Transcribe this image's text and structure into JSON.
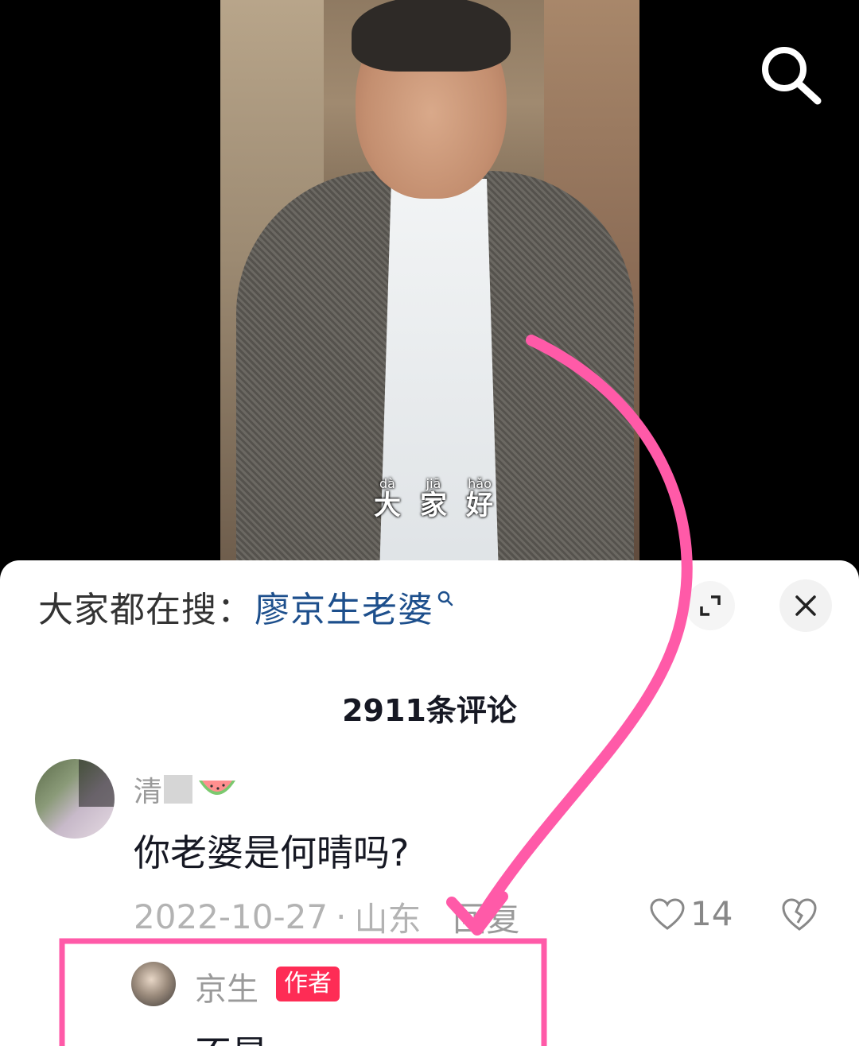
{
  "video": {
    "subtitle": [
      {
        "pinyin": "dà",
        "char": "大"
      },
      {
        "pinyin": "jiā",
        "char": "家"
      },
      {
        "pinyin": "hǎo",
        "char": "好"
      }
    ]
  },
  "icons": {
    "search": "search-icon",
    "expand": "expand-icon",
    "close": "close-icon",
    "heart": "heart-icon",
    "dislike": "broken-heart-icon"
  },
  "hot_search": {
    "prefix": "大家都在搜：",
    "keyword": "廖京生老婆"
  },
  "comments_header": {
    "count_label": "2911条评论"
  },
  "comment": {
    "username": "清",
    "text": "你老婆是何晴吗?",
    "date": "2022-10-27",
    "separator": "·",
    "location": "山东",
    "reply_label": "回复",
    "likes": "14"
  },
  "reply": {
    "username": "京生",
    "badge": "作者",
    "text": "不是"
  },
  "colors": {
    "accent_link": "#1d4f8c",
    "author_badge": "#fe2c55",
    "annotation": "#ff5aa8"
  }
}
